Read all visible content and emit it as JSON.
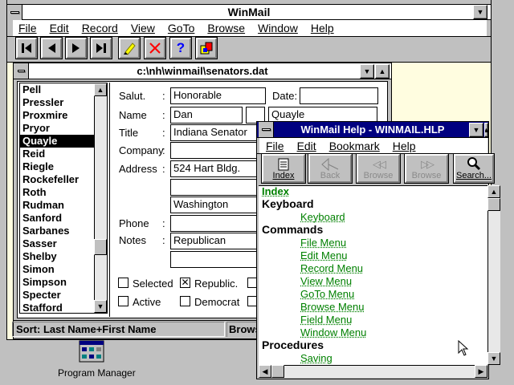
{
  "main_window": {
    "title": "WinMail",
    "menu": [
      "File",
      "Edit",
      "Record",
      "View",
      "GoTo",
      "Browse",
      "Window",
      "Help"
    ]
  },
  "toolbar": {
    "icons": [
      "first-record-icon",
      "previous-record-icon",
      "next-record-icon",
      "last-record-icon",
      "pencil-icon",
      "delete-icon",
      "help-icon",
      "export-icon"
    ]
  },
  "doc_window": {
    "title": "c:\\nh\\winmail\\senators.dat",
    "list_items": [
      "Pell",
      "Pressler",
      "Proxmire",
      "Pryor",
      "Quayle",
      "Reid",
      "Riegle",
      "Rockefeller",
      "Roth",
      "Rudman",
      "Sanford",
      "Sarbanes",
      "Sasser",
      "Shelby",
      "Simon",
      "Simpson",
      "Specter",
      "Stafford"
    ],
    "selected_item": "Quayle",
    "labels": {
      "salut": "Salut.",
      "date": "Date:",
      "name": "Name",
      "title": "Title",
      "company": "Company",
      "address": "Address",
      "phone": "Phone",
      "notes": "Notes",
      "colon": ":"
    },
    "fields": {
      "salut": "Honorable",
      "date": "",
      "first_name": "Dan",
      "middle": "",
      "last_name": "Quayle",
      "title": "Indiana Senator",
      "company": "",
      "address1": "524 Hart Bldg.",
      "address2": "",
      "city": "Washington",
      "phone": "",
      "notes1": "Republican",
      "notes2": ""
    },
    "checkboxes": [
      {
        "label": "Selected",
        "checked": false
      },
      {
        "label": "Republic.",
        "checked": true
      },
      {
        "label": "Active",
        "checked": false
      },
      {
        "label": "Democrat",
        "checked": false
      }
    ],
    "status_sort": "Sort:  Last Name+First Name",
    "status_browse": "Brows"
  },
  "desktop": {
    "icon_label": "Program Manager"
  },
  "help_window": {
    "title": "WinMail Help - WINMAIL.HLP",
    "menu": [
      "File",
      "Edit",
      "Bookmark",
      "Help"
    ],
    "buttons": [
      {
        "label": "Index",
        "enabled": true,
        "icon": "index-icon"
      },
      {
        "label": "Back",
        "enabled": false,
        "icon": "back-icon"
      },
      {
        "label": "Browse",
        "enabled": false,
        "icon": "browse-back-icon"
      },
      {
        "label": "Browse",
        "enabled": false,
        "icon": "browse-forward-icon"
      },
      {
        "label": "Search...",
        "enabled": true,
        "icon": "magnifier-icon"
      }
    ],
    "index_link": "Index",
    "keyboard_heading": "Keyboard",
    "keyboard_link": "Keyboard",
    "commands_heading": "Commands",
    "command_links": [
      "File Menu",
      "Edit Menu",
      "Record Menu",
      "View Menu",
      "GoTo Menu",
      "Browse Menu",
      "Field Menu",
      "Window Menu"
    ],
    "procedures_heading": "Procedures",
    "procedure_links": [
      "Saving"
    ]
  },
  "colors": {
    "active_title": "#000080",
    "desktop_pattern": "#fffde0",
    "link": "#008000"
  }
}
